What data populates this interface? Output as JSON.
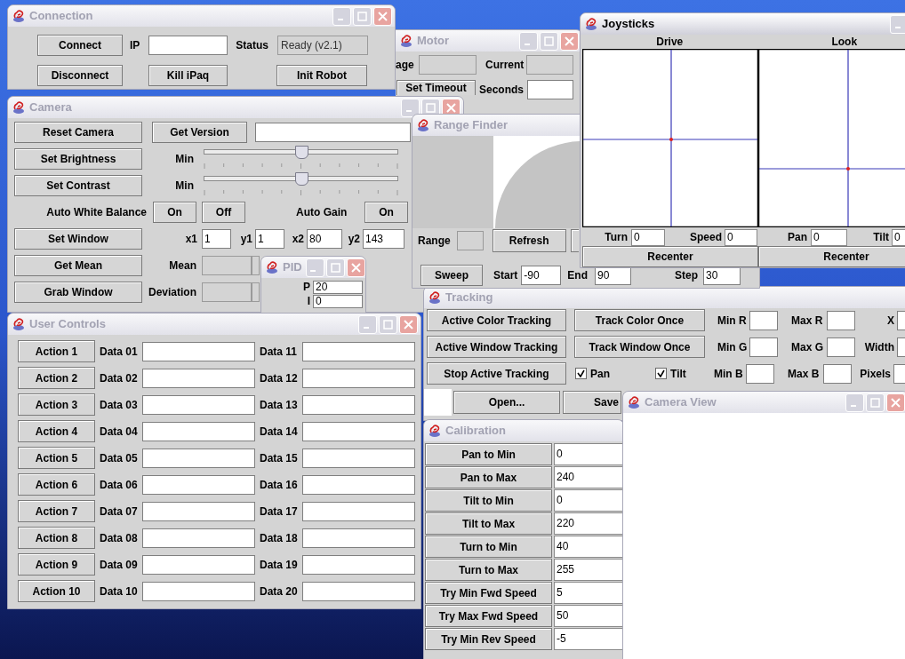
{
  "connection": {
    "title": "Connection",
    "active": false,
    "connect_button": "Connect",
    "ip_label": "IP",
    "status_label": "Status",
    "status_value": "Ready (v2.1)",
    "disconnect_button": "Disconnect",
    "kill_button": "Kill iPaq",
    "init_button": "Init Robot"
  },
  "motor": {
    "title": "Motor",
    "active": false,
    "voltage_label": "age",
    "current_label": "Current",
    "timeout_button": "Set Timeout",
    "seconds_label": "Seconds"
  },
  "camera": {
    "title": "Camera",
    "active": false,
    "reset_button": "Reset Camera",
    "version_button": "Get Version",
    "brightness_button": "Set Brightness",
    "brightness_min": "Min",
    "brightness_slider": {
      "level": 0.5
    },
    "contrast_button": "Set Contrast",
    "contrast_min": "Min",
    "contrast_slider": {
      "level": 0.5
    },
    "awb_label": "Auto White Balance",
    "awb_on": "On",
    "awb_off": "Off",
    "gain_label": "Auto Gain",
    "gain_on": "On",
    "window_button": "Set Window",
    "window_fields": [
      {
        "label": "x1",
        "value": "1"
      },
      {
        "label": "y1",
        "value": "1"
      },
      {
        "label": "x2",
        "value": "80"
      },
      {
        "label": "y2",
        "value": "143"
      }
    ],
    "mean_button": "Get Mean",
    "mean_label": "Mean",
    "grab_button": "Grab Window",
    "deviation_label": "Deviation"
  },
  "pid": {
    "title": "PID",
    "active": false,
    "fields": [
      {
        "label": "P",
        "value": "20"
      },
      {
        "label": "I",
        "value": "0"
      }
    ]
  },
  "user_controls": {
    "title": "User Controls",
    "active": false,
    "rows": [
      {
        "action": "Action 1",
        "data_a": "Data 01",
        "data_b": "Data 11"
      },
      {
        "action": "Action 2",
        "data_a": "Data 02",
        "data_b": "Data 12"
      },
      {
        "action": "Action 3",
        "data_a": "Data 03",
        "data_b": "Data 13"
      },
      {
        "action": "Action 4",
        "data_a": "Data 04",
        "data_b": "Data 14"
      },
      {
        "action": "Action 5",
        "data_a": "Data 05",
        "data_b": "Data 15"
      },
      {
        "action": "Action 6",
        "data_a": "Data 06",
        "data_b": "Data 16"
      },
      {
        "action": "Action 7",
        "data_a": "Data 07",
        "data_b": "Data 17"
      },
      {
        "action": "Action 8",
        "data_a": "Data 08",
        "data_b": "Data 18"
      },
      {
        "action": "Action 9",
        "data_a": "Data 09",
        "data_b": "Data 19"
      },
      {
        "action": "Action 10",
        "data_a": "Data 10",
        "data_b": "Data 20"
      }
    ]
  },
  "range_finder": {
    "title": "Range Finder",
    "active": false,
    "range_label": "Range",
    "refresh_button": "Refresh",
    "sweep_button": "Sweep",
    "start_label": "Start",
    "start_value": "-90",
    "end_label": "End",
    "end_value": "90",
    "step_label": "Step",
    "step_value": "30"
  },
  "joysticks": {
    "title": "Joysticks",
    "active": true,
    "pads": [
      {
        "title": "Drive",
        "fields": [
          {
            "label": "Turn",
            "value": "0"
          },
          {
            "label": "Speed",
            "value": "0"
          }
        ],
        "button": "Recenter"
      },
      {
        "title": "Look",
        "fields": [
          {
            "label": "Pan",
            "value": "0"
          },
          {
            "label": "Tilt",
            "value": "0"
          }
        ],
        "button": "Recenter"
      }
    ]
  },
  "tracking": {
    "title": "Tracking",
    "active": false,
    "rows": [
      {
        "button_a": "Active Color Tracking",
        "button_b": "Track Color Once",
        "min": "Min R",
        "max": "Max R",
        "side": "X"
      },
      {
        "button_a": "Active Window Tracking",
        "button_b": "Track Window Once",
        "min": "Min G",
        "max": "Max G",
        "side": "Width"
      },
      {
        "button_a": "Stop Active Tracking",
        "min": "Min B",
        "max": "Max B",
        "side": "Pixels"
      }
    ],
    "checks": [
      {
        "label": "Pan",
        "checked": true
      },
      {
        "label": "Tilt",
        "checked": true
      }
    ],
    "open_button": "Open...",
    "save_button": "Save"
  },
  "calibration": {
    "title": "Calibration",
    "active": false,
    "rows": [
      {
        "label": "Pan to Min",
        "value": "0"
      },
      {
        "label": "Pan to Max",
        "value": "240"
      },
      {
        "label": "Tilt to Min",
        "value": "0"
      },
      {
        "label": "Tilt to Max",
        "value": "220"
      },
      {
        "label": "Turn to Min",
        "value": "40"
      },
      {
        "label": "Turn to Max",
        "value": "255"
      },
      {
        "label": "Try Min Fwd Speed",
        "value": "5"
      },
      {
        "label": "Try Max Fwd Speed",
        "value": "50"
      },
      {
        "label": "Try Min Rev Speed",
        "value": "-5"
      }
    ]
  },
  "camera_view": {
    "title": "Camera View",
    "active": false
  }
}
